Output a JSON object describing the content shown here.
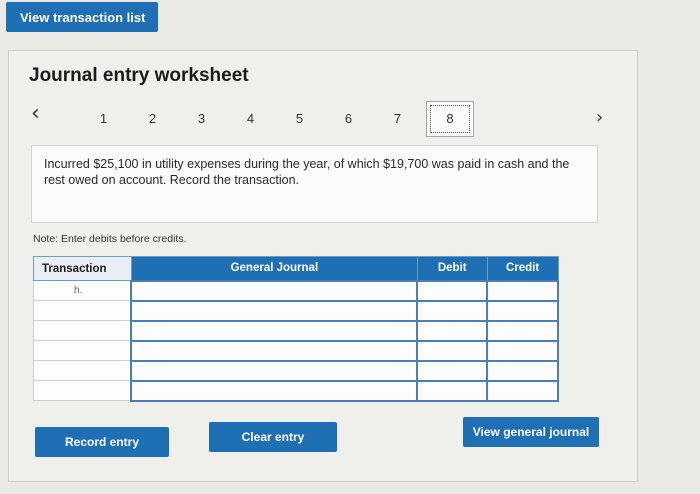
{
  "top_button": "View transaction list",
  "worksheet": {
    "title": "Journal entry worksheet",
    "steps": [
      "1",
      "2",
      "3",
      "4",
      "5",
      "6",
      "7",
      "8"
    ],
    "active_step": "8",
    "problem_text": "Incurred $25,100 in utility expenses during the year, of which $19,700 was paid in cash and the rest owed on account. Record the transaction.",
    "note": "Note: Enter debits before credits."
  },
  "table": {
    "headers": {
      "transaction": "Transaction",
      "general_journal": "General Journal",
      "debit": "Debit",
      "credit": "Credit"
    },
    "rows": [
      {
        "transaction": "h."
      },
      {
        "transaction": ""
      },
      {
        "transaction": ""
      },
      {
        "transaction": ""
      },
      {
        "transaction": ""
      },
      {
        "transaction": ""
      }
    ]
  },
  "buttons": {
    "record": "Record entry",
    "clear": "Clear entry",
    "view_journal": "View general journal"
  },
  "icons": {
    "prev": "chevron-left-icon",
    "next": "chevron-right-icon"
  }
}
